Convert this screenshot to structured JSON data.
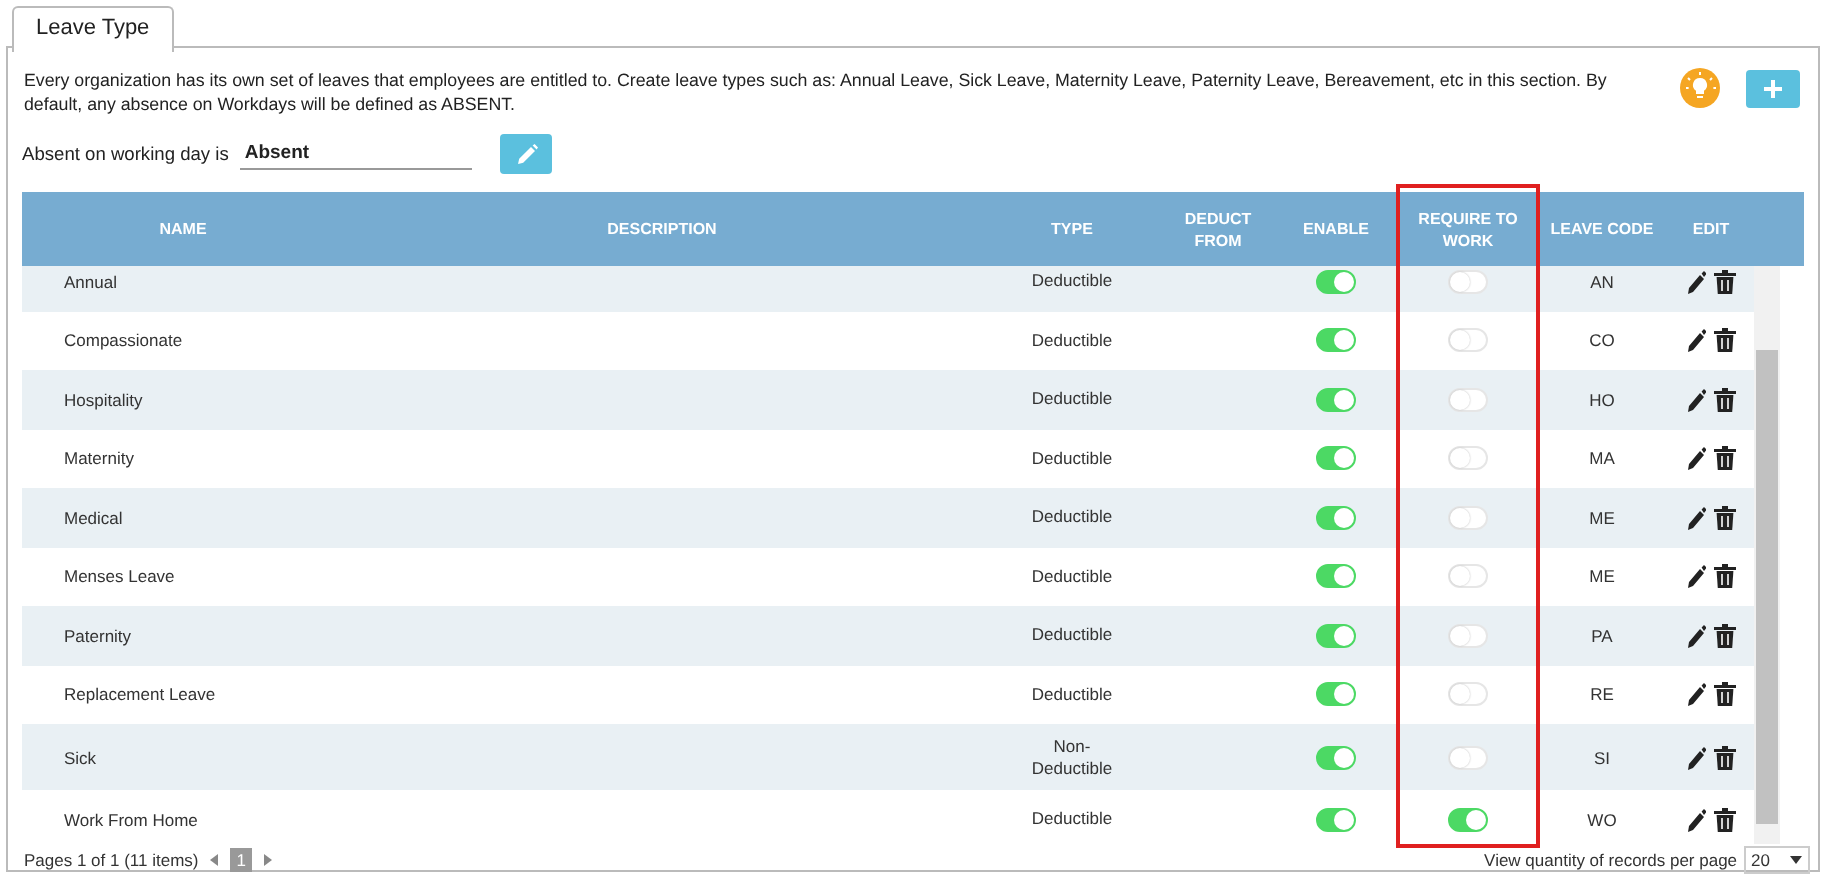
{
  "tabs": [
    {
      "label": "Leave Type",
      "selected": true
    }
  ],
  "intro": "Every organization has its own set of leaves that employees are entitled to. Create leave types such as: Annual Leave, Sick Leave, Maternity Leave, Paternity Leave, Bereavement, etc in this section. By default, any absence on Workdays will be defined as ABSENT.",
  "absent_setting": {
    "label": "Absent on working day is",
    "value": "Absent"
  },
  "table": {
    "columns": [
      {
        "label": "NAME",
        "highlighted": false
      },
      {
        "label": "DESCRIPTION",
        "highlighted": false
      },
      {
        "label": "TYPE",
        "highlighted": false
      },
      {
        "label": "DEDUCT FROM",
        "highlighted": false
      },
      {
        "label": "ENABLE",
        "highlighted": false
      },
      {
        "label": "REQUIRE TO WORK",
        "highlighted": true
      },
      {
        "label": "LEAVE CODE",
        "highlighted": false
      },
      {
        "label": "EDIT",
        "highlighted": false
      }
    ],
    "rows": [
      {
        "name": "Annual",
        "type": "Deductible",
        "enabled": true,
        "require_to_work": false,
        "code": "AN"
      },
      {
        "name": "Compassionate",
        "type": "Deductible",
        "enabled": true,
        "require_to_work": false,
        "code": "CO"
      },
      {
        "name": "Hospitality",
        "type": "Deductible",
        "enabled": true,
        "require_to_work": false,
        "code": "HO"
      },
      {
        "name": "Maternity",
        "type": "Deductible",
        "enabled": true,
        "require_to_work": false,
        "code": "MA"
      },
      {
        "name": "Medical",
        "type": "Deductible",
        "enabled": true,
        "require_to_work": false,
        "code": "ME"
      },
      {
        "name": "Menses Leave",
        "type": "Deductible",
        "enabled": true,
        "require_to_work": false,
        "code": "ME"
      },
      {
        "name": "Paternity",
        "type": "Deductible",
        "enabled": true,
        "require_to_work": false,
        "code": "PA"
      },
      {
        "name": "Replacement Leave",
        "type": "Deductible",
        "enabled": true,
        "require_to_work": false,
        "code": "RE"
      },
      {
        "name": "Sick",
        "type": "Non-\nDeductible",
        "enabled": true,
        "require_to_work": false,
        "code": "SI"
      },
      {
        "name": "Work From Home",
        "type": "Deductible",
        "enabled": true,
        "require_to_work": true,
        "code": "WO"
      }
    ]
  },
  "pager": {
    "summary": "Pages 1 of 1 (11 items)",
    "pages": [
      {
        "label": "1",
        "selected": true
      }
    ]
  },
  "page_size": {
    "label": "View quantity of records per page",
    "value": "20"
  }
}
